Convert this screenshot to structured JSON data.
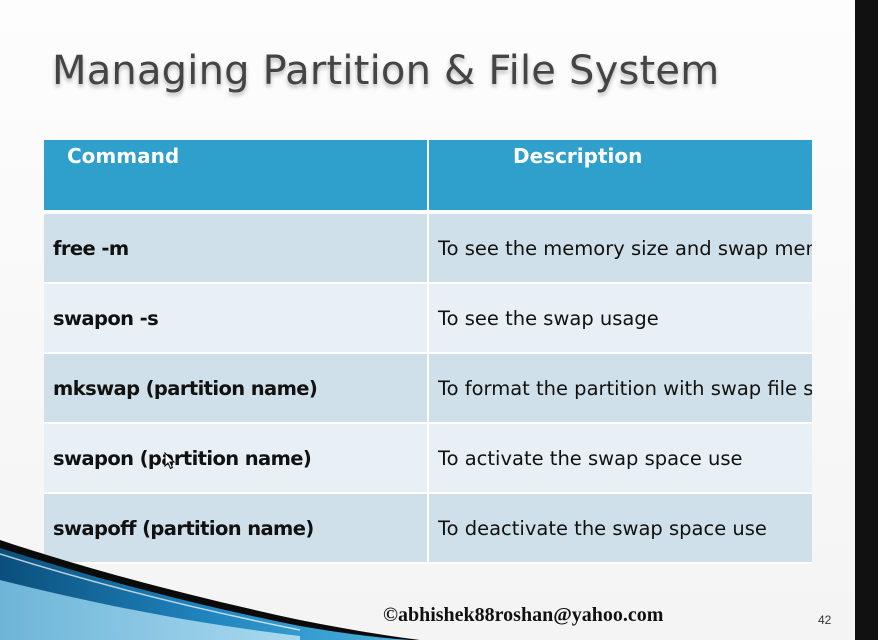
{
  "slide": {
    "title": "Managing Partition & File System",
    "table": {
      "headers": [
        "Command",
        "Description"
      ],
      "rows": [
        {
          "command": "free -m",
          "description": "To see the memory size and swap memory"
        },
        {
          "command": "swapon -s",
          "description": "To see the swap usage"
        },
        {
          "command": "mkswap (partition name)",
          "description": "To format the partition with swap file system"
        },
        {
          "command": "swapon (partition name)",
          "description": "To activate the swap space use"
        },
        {
          "command": "swapoff (partition name)",
          "description": "To deactivate the swap space use"
        }
      ]
    },
    "footer": {
      "email": "©abhishek88roshan@yahoo.com",
      "page_number": "42"
    }
  },
  "colors": {
    "header_bg": "#2f9fcc",
    "row_odd": "#cfe0ea",
    "row_even": "#e8f0f5",
    "title_text": "#444444"
  },
  "icons": [
    "mouse-pointer-icon"
  ]
}
